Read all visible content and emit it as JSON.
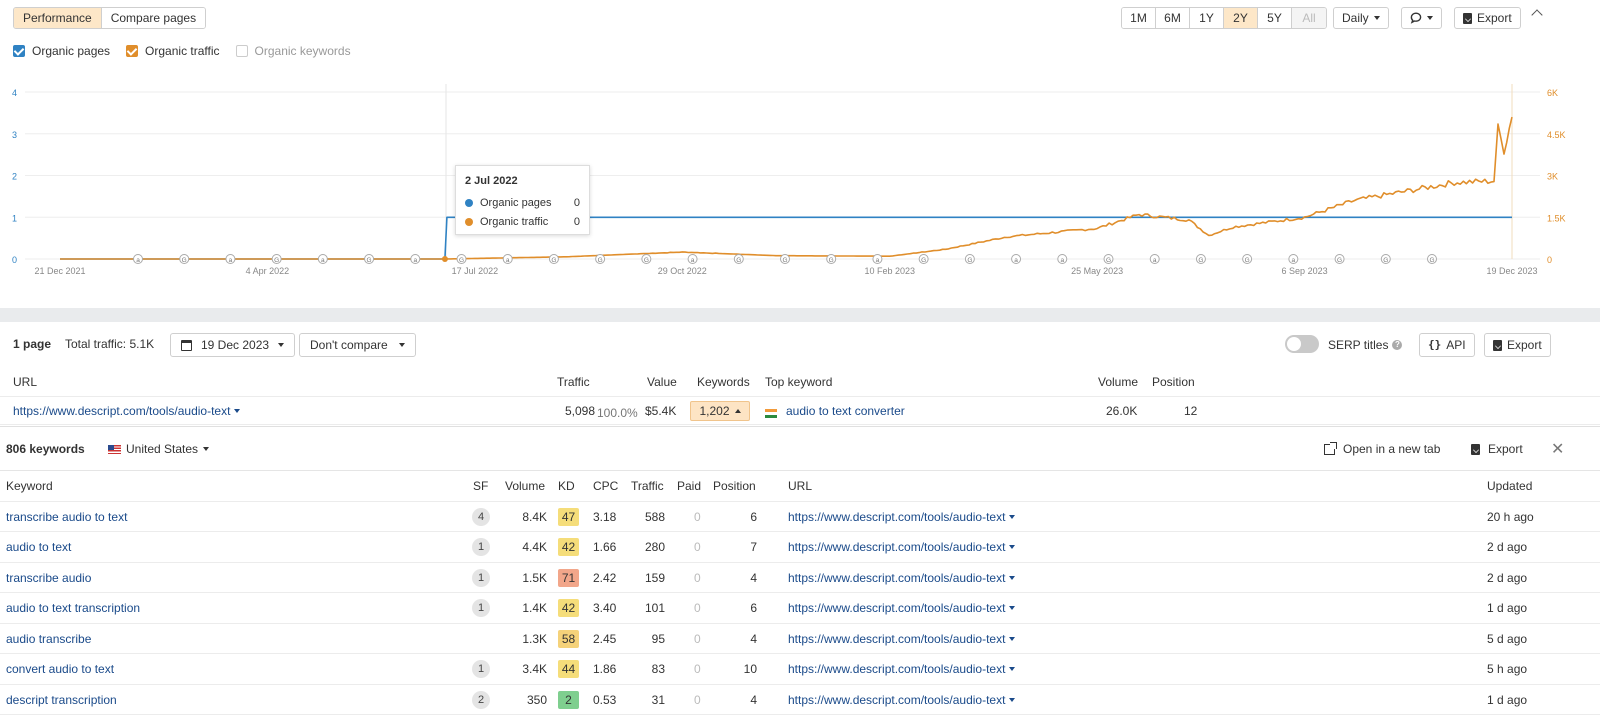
{
  "toolbar": {
    "tabs": [
      {
        "label": "Performance",
        "active": true
      },
      {
        "label": "Compare pages",
        "active": false
      }
    ],
    "ranges": [
      {
        "label": "1M",
        "state": "normal"
      },
      {
        "label": "6M",
        "state": "normal"
      },
      {
        "label": "1Y",
        "state": "normal"
      },
      {
        "label": "2Y",
        "state": "active"
      },
      {
        "label": "5Y",
        "state": "normal"
      },
      {
        "label": "All",
        "state": "disabled"
      }
    ],
    "interval": "Daily",
    "export_label": "Export"
  },
  "legend": [
    {
      "label": "Organic pages",
      "checked": true,
      "color": "#2f82c3"
    },
    {
      "label": "Organic traffic",
      "checked": true,
      "color": "#e08e2b"
    },
    {
      "label": "Organic keywords",
      "checked": false,
      "color": "#cccccc"
    }
  ],
  "chart_data": {
    "type": "line",
    "x_ticks": [
      "21 Dec 2021",
      "4 Apr 2022",
      "17 Jul 2022",
      "29 Oct 2022",
      "10 Feb 2023",
      "25 May 2023",
      "6 Sep 2023",
      "19 Dec 2023"
    ],
    "y_left_ticks": [
      "0",
      "1",
      "2",
      "3",
      "4"
    ],
    "y_right_ticks": [
      "0",
      "1.5K",
      "3K",
      "4.5K",
      "6K"
    ],
    "series": [
      {
        "name": "Organic pages",
        "color": "#2f82c3",
        "axis": "left",
        "points": [
          [
            "21 Dec 2021",
            0
          ],
          [
            "2 Jul 2022",
            0
          ],
          [
            "3 Jul 2022",
            1
          ],
          [
            "19 Dec 2023",
            1
          ]
        ]
      },
      {
        "name": "Organic traffic",
        "color": "#e08e2b",
        "axis": "right",
        "points": [
          [
            "21 Dec 2021",
            0
          ],
          [
            "4 Apr 2022",
            0
          ],
          [
            "2 Jul 2022",
            0
          ],
          [
            "17 Jul 2022",
            20
          ],
          [
            "1 Sep 2022",
            80
          ],
          [
            "29 Oct 2022",
            250
          ],
          [
            "15 Dec 2022",
            120
          ],
          [
            "10 Feb 2023",
            100
          ],
          [
            "10 Mar 2023",
            350
          ],
          [
            "10 Apr 2023",
            800
          ],
          [
            "25 May 2023",
            1100
          ],
          [
            "15 Jun 2023",
            1600
          ],
          [
            "10 Jul 2023",
            1400
          ],
          [
            "20 Jul 2023",
            850
          ],
          [
            "1 Aug 2023",
            1150
          ],
          [
            "6 Sep 2023",
            1500
          ],
          [
            "1 Oct 2023",
            2100
          ],
          [
            "1 Nov 2023",
            2500
          ],
          [
            "20 Nov 2023",
            2750
          ],
          [
            "10 Dec 2023",
            2800
          ],
          [
            "12 Dec 2023",
            4700
          ],
          [
            "15 Dec 2023",
            3900
          ],
          [
            "19 Dec 2023",
            5100
          ]
        ]
      }
    ],
    "annotation_markers": [
      "a",
      "G",
      "a",
      "G",
      "a",
      "G",
      "a",
      "G",
      "a",
      "G",
      "G",
      "G",
      "a",
      "G",
      "G",
      "G",
      "a",
      "G",
      "G",
      "a",
      "a",
      "G",
      "a",
      "G",
      "G",
      "a",
      "G",
      "G",
      "G"
    ],
    "tooltip": {
      "date": "2 Jul 2022",
      "rows": [
        {
          "name": "Organic pages",
          "value": "0",
          "color": "#2f82c3"
        },
        {
          "name": "Organic traffic",
          "value": "0",
          "color": "#e08e2b"
        }
      ]
    }
  },
  "summary": {
    "pages": "1 page",
    "total_traffic": "Total traffic: 5.1K",
    "date": "19 Dec 2023",
    "compare": "Don't compare",
    "serp_titles": "SERP titles",
    "api": "API",
    "export": "Export"
  },
  "pages_table": {
    "headers": {
      "url": "URL",
      "traffic": "Traffic",
      "value": "Value",
      "keywords": "Keywords",
      "top_keyword": "Top keyword",
      "volume": "Volume",
      "position": "Position"
    },
    "row": {
      "url": "https://www.descript.com/tools/audio-text",
      "traffic": "5,098",
      "traffic_pct": "100.0%",
      "value": "$5.4K",
      "keywords": "1,202",
      "top_keyword": "audio to text converter",
      "volume": "26.0K",
      "position": "12"
    }
  },
  "keywords_panel": {
    "count": "806 keywords",
    "country": "United States",
    "open_tab": "Open in a new tab",
    "export": "Export",
    "headers": {
      "keyword": "Keyword",
      "sf": "SF",
      "volume": "Volume",
      "kd": "KD",
      "cpc": "CPC",
      "traffic": "Traffic",
      "paid": "Paid",
      "position": "Position",
      "url": "URL",
      "updated": "Updated"
    },
    "rows": [
      {
        "keyword": "transcribe audio to text",
        "sf": "4",
        "volume": "8.4K",
        "kd": "47",
        "kd_color": "#f5dd7a",
        "cpc": "3.18",
        "traffic": "588",
        "paid": "0",
        "position": "6",
        "url": "https://www.descript.com/tools/audio-text",
        "updated": "20 h ago"
      },
      {
        "keyword": "audio to text",
        "sf": "1",
        "volume": "4.4K",
        "kd": "42",
        "kd_color": "#f5dd7a",
        "cpc": "1.66",
        "traffic": "280",
        "paid": "0",
        "position": "7",
        "url": "https://www.descript.com/tools/audio-text",
        "updated": "2 d ago"
      },
      {
        "keyword": "transcribe audio",
        "sf": "1",
        "volume": "1.5K",
        "kd": "71",
        "kd_color": "#f2a68a",
        "cpc": "2.42",
        "traffic": "159",
        "paid": "0",
        "position": "4",
        "url": "https://www.descript.com/tools/audio-text",
        "updated": "2 d ago"
      },
      {
        "keyword": "audio to text transcription",
        "sf": "1",
        "volume": "1.4K",
        "kd": "42",
        "kd_color": "#f5dd7a",
        "cpc": "3.40",
        "traffic": "101",
        "paid": "0",
        "position": "6",
        "url": "https://www.descript.com/tools/audio-text",
        "updated": "1 d ago"
      },
      {
        "keyword": "audio transcribe",
        "sf": "",
        "volume": "1.3K",
        "kd": "58",
        "kd_color": "#f5d27a",
        "cpc": "2.45",
        "traffic": "95",
        "paid": "0",
        "position": "4",
        "url": "https://www.descript.com/tools/audio-text",
        "updated": "5 d ago"
      },
      {
        "keyword": "convert audio to text",
        "sf": "1",
        "volume": "3.4K",
        "kd": "44",
        "kd_color": "#f5dd7a",
        "cpc": "1.86",
        "traffic": "83",
        "paid": "0",
        "position": "10",
        "url": "https://www.descript.com/tools/audio-text",
        "updated": "5 h ago"
      },
      {
        "keyword": "descript transcription",
        "sf": "2",
        "volume": "350",
        "kd": "2",
        "kd_color": "#7fcf8f",
        "cpc": "0.53",
        "traffic": "31",
        "paid": "0",
        "position": "4",
        "url": "https://www.descript.com/tools/audio-text",
        "updated": "1 d ago"
      }
    ]
  }
}
